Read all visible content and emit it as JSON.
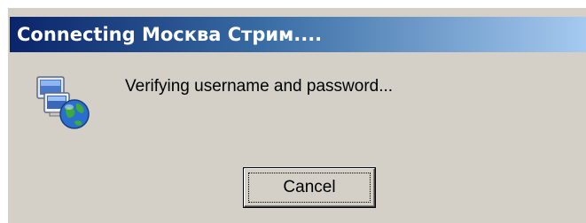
{
  "window": {
    "title": "Connecting Москва Стрим...."
  },
  "body": {
    "message": "Verifying username and password...",
    "icon": "network-connection-globe-icon"
  },
  "buttons": {
    "cancel_label": "Cancel"
  },
  "colors": {
    "title_gradient_start": "#0a246a",
    "title_gradient_end": "#a6caf0",
    "dialog_face": "#d4d0c8"
  }
}
